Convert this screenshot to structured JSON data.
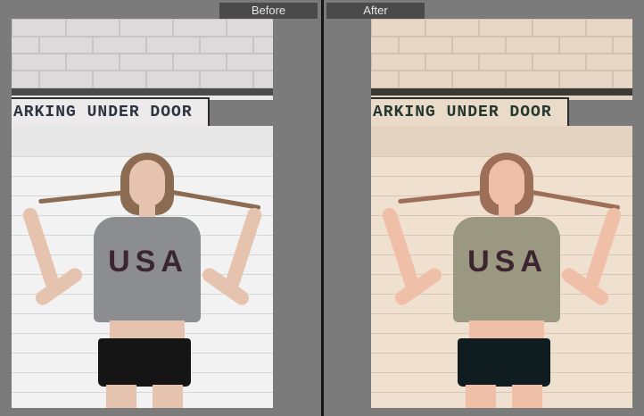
{
  "before": {
    "label": "Before",
    "sign_text": "ARKING UNDER DOOR",
    "shirt_text": "USA",
    "colors": {
      "wall": "#dcdada",
      "brick_line": "#c7c4c4",
      "beam": "#4a4a4a",
      "door": "#f2f2f2",
      "door_top": "#e7e7e7",
      "slat": "#d6d6d6",
      "sign_bg": "#eceaea",
      "sign_text": "#2d3340",
      "skin": "#e6c3ae",
      "hair": "#8b6b52",
      "shirt": "#8c8d91",
      "shirt_letters": "#3a2630",
      "shorts": "#151515"
    }
  },
  "after": {
    "label": "After",
    "sign_text": "ARKING UNDER DOOR",
    "shirt_text": "USA",
    "colors": {
      "wall": "#e8d6c6",
      "brick_line": "#d3c1b1",
      "beam": "#3b3a35",
      "door": "#efe0cf",
      "door_top": "#e4d3c1",
      "slat": "#d9c7b6",
      "sign_bg": "#eadbc9",
      "sign_text": "#24372f",
      "skin": "#f0bfa8",
      "hair": "#9d6f58",
      "shirt": "#9a9880",
      "shirt_letters": "#3c2430",
      "shorts": "#0f1d21"
    }
  }
}
